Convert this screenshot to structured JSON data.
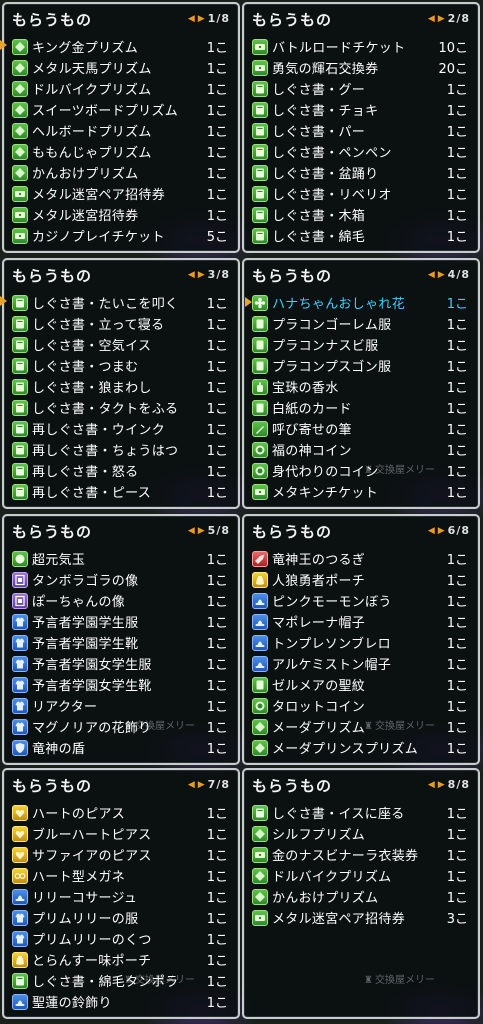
{
  "panels": [
    {
      "title": "もらうもの",
      "page": "1/8",
      "watermark": "",
      "items": [
        {
          "icon": "prism-icon",
          "name": "キング金プリズム",
          "count": "1こ"
        },
        {
          "icon": "prism-icon",
          "name": "メタル天馬プリズム",
          "count": "1こ"
        },
        {
          "icon": "prism-icon",
          "name": "ドルバイクプリズム",
          "count": "1こ"
        },
        {
          "icon": "prism-icon",
          "name": "スイーツボードプリズム",
          "count": "1こ"
        },
        {
          "icon": "prism-icon",
          "name": "ヘルボードプリズム",
          "count": "1こ"
        },
        {
          "icon": "prism-icon",
          "name": "ももんじゃプリズム",
          "count": "1こ"
        },
        {
          "icon": "prism-icon",
          "name": "かんおけプリズム",
          "count": "1こ"
        },
        {
          "icon": "ticket-icon",
          "name": "メタル迷宮ペア招待券",
          "count": "1こ"
        },
        {
          "icon": "ticket-icon",
          "name": "メタル迷宮招待券",
          "count": "1こ"
        },
        {
          "icon": "ticket-icon",
          "name": "カジノプレイチケット",
          "count": "5こ"
        }
      ]
    },
    {
      "title": "もらうもの",
      "page": "2/8",
      "watermark": "",
      "items": [
        {
          "icon": "ticket-icon",
          "name": "バトルロードチケット",
          "count": "10こ"
        },
        {
          "icon": "ticket-icon",
          "name": "勇気の輝石交換券",
          "count": "20こ"
        },
        {
          "icon": "book-icon",
          "name": "しぐさ書・グー",
          "count": "1こ"
        },
        {
          "icon": "book-icon",
          "name": "しぐさ書・チョキ",
          "count": "1こ"
        },
        {
          "icon": "book-icon",
          "name": "しぐさ書・パー",
          "count": "1こ"
        },
        {
          "icon": "book-icon",
          "name": "しぐさ書・ペンペン",
          "count": "1こ"
        },
        {
          "icon": "book-icon",
          "name": "しぐさ書・盆踊り",
          "count": "1こ"
        },
        {
          "icon": "book-icon",
          "name": "しぐさ書・リベリオ",
          "count": "1こ"
        },
        {
          "icon": "book-icon",
          "name": "しぐさ書・木箱",
          "count": "1こ"
        },
        {
          "icon": "book-icon",
          "name": "しぐさ書・綿毛",
          "count": "1こ"
        }
      ]
    },
    {
      "title": "もらうもの",
      "page": "3/8",
      "watermark": "",
      "items": [
        {
          "icon": "book-icon",
          "name": "しぐさ書・たいこを叩く",
          "count": "1こ"
        },
        {
          "icon": "book-icon",
          "name": "しぐさ書・立って寝る",
          "count": "1こ"
        },
        {
          "icon": "book-icon",
          "name": "しぐさ書・空気イス",
          "count": "1こ"
        },
        {
          "icon": "book-icon",
          "name": "しぐさ書・つまむ",
          "count": "1こ"
        },
        {
          "icon": "book-icon",
          "name": "しぐさ書・狼まわし",
          "count": "1こ"
        },
        {
          "icon": "book-icon",
          "name": "しぐさ書・タクトをふる",
          "count": "1こ"
        },
        {
          "icon": "book-icon",
          "name": "再しぐさ書・ウインク",
          "count": "1こ"
        },
        {
          "icon": "book-icon",
          "name": "再しぐさ書・ちょうはつ",
          "count": "1こ"
        },
        {
          "icon": "book-icon",
          "name": "再しぐさ書・怒る",
          "count": "1こ"
        },
        {
          "icon": "book-icon",
          "name": "再しぐさ書・ピース",
          "count": "1こ"
        }
      ]
    },
    {
      "title": "もらうもの",
      "page": "4/8",
      "watermark": "交換屋メリー",
      "items": [
        {
          "icon": "flower-icon",
          "name": "ハナちゃんおしゃれ花",
          "count": "1こ",
          "highlight": true
        },
        {
          "icon": "card-icon",
          "name": "プラコンゴーレム服",
          "count": "1こ"
        },
        {
          "icon": "card-icon",
          "name": "プラコンナスビ服",
          "count": "1こ"
        },
        {
          "icon": "card-icon",
          "name": "プラコンプスゴン服",
          "count": "1こ"
        },
        {
          "icon": "perfume-icon",
          "name": "宝珠の香水",
          "count": "1こ"
        },
        {
          "icon": "card-icon",
          "name": "白紙のカード",
          "count": "1こ"
        },
        {
          "icon": "pen-icon",
          "name": "呼び寄せの筆",
          "count": "1こ"
        },
        {
          "icon": "coin-icon",
          "name": "福の神コイン",
          "count": "1こ"
        },
        {
          "icon": "coin-icon",
          "name": "身代わりのコイン",
          "count": "1こ"
        },
        {
          "icon": "ticket-icon",
          "name": "メタキンチケット",
          "count": "1こ"
        }
      ]
    },
    {
      "title": "もらうもの",
      "page": "5/8",
      "watermark": "交換屋メリー",
      "items": [
        {
          "icon": "orb-icon",
          "name": "超元気玉",
          "count": "1こ"
        },
        {
          "icon": "statue-icon",
          "name": "タンボラゴラの像",
          "count": "1こ"
        },
        {
          "icon": "statue-icon",
          "name": "ぽーちゃんの像",
          "count": "1こ"
        },
        {
          "icon": "clothes-icon",
          "name": "予言者学園学生服",
          "count": "1こ"
        },
        {
          "icon": "clothes-icon",
          "name": "予言者学園学生靴",
          "count": "1こ"
        },
        {
          "icon": "clothes-icon",
          "name": "予言者学園女学生服",
          "count": "1こ"
        },
        {
          "icon": "clothes-icon",
          "name": "予言者学園女学生靴",
          "count": "1こ"
        },
        {
          "icon": "clothes-icon",
          "name": "リアクター",
          "count": "1こ"
        },
        {
          "icon": "clothes-icon",
          "name": "マグノリアの花飾り",
          "count": "1こ"
        },
        {
          "icon": "shield-icon",
          "name": "竜神の盾",
          "count": "1こ"
        }
      ]
    },
    {
      "title": "もらうもの",
      "page": "6/8",
      "watermark": "交換屋メリー",
      "items": [
        {
          "icon": "sword-icon",
          "name": "竜神王のつるぎ",
          "count": "1こ"
        },
        {
          "icon": "pouch-icon",
          "name": "人狼勇者ポーチ",
          "count": "1こ"
        },
        {
          "icon": "hat-icon",
          "name": "ピンクモーモンぼう",
          "count": "1こ"
        },
        {
          "icon": "hat-icon",
          "name": "マポレーナ帽子",
          "count": "1こ"
        },
        {
          "icon": "hat-icon",
          "name": "トンプレソンブレロ",
          "count": "1こ"
        },
        {
          "icon": "hat-icon",
          "name": "アルケミストン帽子",
          "count": "1こ"
        },
        {
          "icon": "card-icon",
          "name": "ゼルメアの聖紋",
          "count": "1こ"
        },
        {
          "icon": "coin-icon",
          "name": "タロットコイン",
          "count": "1こ"
        },
        {
          "icon": "prism-icon",
          "name": "メーダプリズム",
          "count": "1こ"
        },
        {
          "icon": "prism-icon",
          "name": "メーダプリンスプリズム",
          "count": "1こ"
        }
      ]
    },
    {
      "title": "もらうもの",
      "page": "7/8",
      "watermark": "交換屋メリー",
      "items": [
        {
          "icon": "earring-icon",
          "name": "ハートのピアス",
          "count": "1こ"
        },
        {
          "icon": "earring-icon",
          "name": "ブルーハートピアス",
          "count": "1こ"
        },
        {
          "icon": "earring-icon",
          "name": "サファイアのピアス",
          "count": "1こ"
        },
        {
          "icon": "glasses-icon",
          "name": "ハート型メガネ",
          "count": "1こ"
        },
        {
          "icon": "hat-icon",
          "name": "リリーコサージュ",
          "count": "1こ"
        },
        {
          "icon": "clothes-icon",
          "name": "プリムリリーの服",
          "count": "1こ"
        },
        {
          "icon": "clothes-icon",
          "name": "プリムリリーのくつ",
          "count": "1こ"
        },
        {
          "icon": "pouch-icon",
          "name": "とらんすー味ポーチ",
          "count": "1こ"
        },
        {
          "icon": "book-icon",
          "name": "しぐさ書・綿毛タンポラ",
          "count": "1こ"
        },
        {
          "icon": "hat-icon",
          "name": "聖蓮の鈴飾り",
          "count": "1こ"
        }
      ]
    },
    {
      "title": "もらうもの",
      "page": "8/8",
      "watermark": "交換屋メリー",
      "items": [
        {
          "icon": "book-icon",
          "name": "しぐさ書・イスに座る",
          "count": "1こ"
        },
        {
          "icon": "prism-icon",
          "name": "シルフプリズム",
          "count": "1こ"
        },
        {
          "icon": "ticket-icon",
          "name": "金のナスビナーラ衣装券",
          "count": "1こ"
        },
        {
          "icon": "prism-icon",
          "name": "ドルバイクプリズム",
          "count": "1こ"
        },
        {
          "icon": "prism-icon",
          "name": "かんおけプリズム",
          "count": "1こ"
        },
        {
          "icon": "ticket-icon",
          "name": "メタル迷宮ペア招待券",
          "count": "3こ"
        }
      ]
    }
  ]
}
